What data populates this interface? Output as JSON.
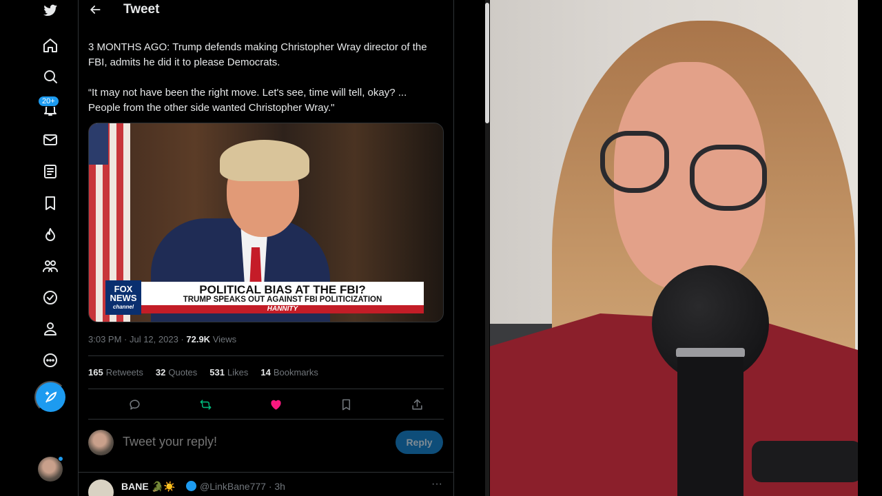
{
  "app": {
    "name": "Twitter"
  },
  "sidebar": {
    "badge": "20+",
    "items": [
      {
        "name": "logo",
        "icon": "twitter-bird-icon"
      },
      {
        "name": "home",
        "icon": "home-icon"
      },
      {
        "name": "explore",
        "icon": "search-icon"
      },
      {
        "name": "notifications",
        "icon": "bell-icon"
      },
      {
        "name": "messages",
        "icon": "mail-icon"
      },
      {
        "name": "lists",
        "icon": "list-icon"
      },
      {
        "name": "bookmarks",
        "icon": "bookmark-icon"
      },
      {
        "name": "trending",
        "icon": "fire-icon"
      },
      {
        "name": "communities",
        "icon": "people-icon"
      },
      {
        "name": "verified",
        "icon": "verified-icon"
      },
      {
        "name": "profile",
        "icon": "person-icon"
      },
      {
        "name": "more",
        "icon": "more-circle-icon"
      }
    ]
  },
  "header": {
    "title": "Tweet"
  },
  "tweet": {
    "text_1": "3 MONTHS AGO: Trump defends making Christopher Wray director of the FBI, admits he did it to please Democrats.",
    "text_2": "“It may not have been the right move. Let's see, time will tell, okay? ... People from the other side wanted Christopher Wray.\"",
    "media": {
      "logo_line1": "FOX",
      "logo_line2": "NEWS",
      "logo_line3": "channel",
      "headline": "POLITICAL BIAS AT THE FBI?",
      "subline": "TRUMP SPEAKS OUT AGAINST FBI POLITICIZATION",
      "show": "HANNITY"
    },
    "time": "3:03 PM · Jul 12, 2023 ·",
    "views_count": "72.9K",
    "views_label": "Views",
    "stats": [
      {
        "count": "165",
        "label": "Retweets"
      },
      {
        "count": "32",
        "label": "Quotes"
      },
      {
        "count": "531",
        "label": "Likes"
      },
      {
        "count": "14",
        "label": "Bookmarks"
      }
    ]
  },
  "reply": {
    "placeholder": "Tweet your reply!",
    "button": "Reply"
  },
  "next_tweet": {
    "name": "BANE 🐊☀️",
    "handle": "@LinkBane777 · 3h",
    "more": "···"
  },
  "colors": {
    "accent": "#1d9bf0",
    "like": "#f91880",
    "retweet": "#00ba7c"
  }
}
